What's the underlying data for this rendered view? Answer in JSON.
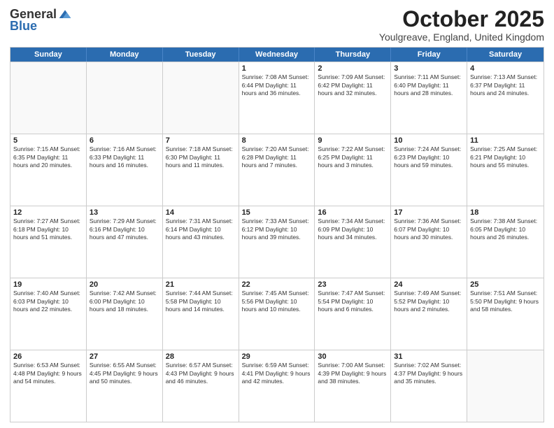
{
  "header": {
    "logo_general": "General",
    "logo_blue": "Blue",
    "title": "October 2025",
    "subtitle": "Youlgreave, England, United Kingdom"
  },
  "weekdays": [
    "Sunday",
    "Monday",
    "Tuesday",
    "Wednesday",
    "Thursday",
    "Friday",
    "Saturday"
  ],
  "rows": [
    [
      {
        "day": "",
        "info": ""
      },
      {
        "day": "",
        "info": ""
      },
      {
        "day": "",
        "info": ""
      },
      {
        "day": "1",
        "info": "Sunrise: 7:08 AM\nSunset: 6:44 PM\nDaylight: 11 hours\nand 36 minutes."
      },
      {
        "day": "2",
        "info": "Sunrise: 7:09 AM\nSunset: 6:42 PM\nDaylight: 11 hours\nand 32 minutes."
      },
      {
        "day": "3",
        "info": "Sunrise: 7:11 AM\nSunset: 6:40 PM\nDaylight: 11 hours\nand 28 minutes."
      },
      {
        "day": "4",
        "info": "Sunrise: 7:13 AM\nSunset: 6:37 PM\nDaylight: 11 hours\nand 24 minutes."
      }
    ],
    [
      {
        "day": "5",
        "info": "Sunrise: 7:15 AM\nSunset: 6:35 PM\nDaylight: 11 hours\nand 20 minutes."
      },
      {
        "day": "6",
        "info": "Sunrise: 7:16 AM\nSunset: 6:33 PM\nDaylight: 11 hours\nand 16 minutes."
      },
      {
        "day": "7",
        "info": "Sunrise: 7:18 AM\nSunset: 6:30 PM\nDaylight: 11 hours\nand 11 minutes."
      },
      {
        "day": "8",
        "info": "Sunrise: 7:20 AM\nSunset: 6:28 PM\nDaylight: 11 hours\nand 7 minutes."
      },
      {
        "day": "9",
        "info": "Sunrise: 7:22 AM\nSunset: 6:25 PM\nDaylight: 11 hours\nand 3 minutes."
      },
      {
        "day": "10",
        "info": "Sunrise: 7:24 AM\nSunset: 6:23 PM\nDaylight: 10 hours\nand 59 minutes."
      },
      {
        "day": "11",
        "info": "Sunrise: 7:25 AM\nSunset: 6:21 PM\nDaylight: 10 hours\nand 55 minutes."
      }
    ],
    [
      {
        "day": "12",
        "info": "Sunrise: 7:27 AM\nSunset: 6:18 PM\nDaylight: 10 hours\nand 51 minutes."
      },
      {
        "day": "13",
        "info": "Sunrise: 7:29 AM\nSunset: 6:16 PM\nDaylight: 10 hours\nand 47 minutes."
      },
      {
        "day": "14",
        "info": "Sunrise: 7:31 AM\nSunset: 6:14 PM\nDaylight: 10 hours\nand 43 minutes."
      },
      {
        "day": "15",
        "info": "Sunrise: 7:33 AM\nSunset: 6:12 PM\nDaylight: 10 hours\nand 39 minutes."
      },
      {
        "day": "16",
        "info": "Sunrise: 7:34 AM\nSunset: 6:09 PM\nDaylight: 10 hours\nand 34 minutes."
      },
      {
        "day": "17",
        "info": "Sunrise: 7:36 AM\nSunset: 6:07 PM\nDaylight: 10 hours\nand 30 minutes."
      },
      {
        "day": "18",
        "info": "Sunrise: 7:38 AM\nSunset: 6:05 PM\nDaylight: 10 hours\nand 26 minutes."
      }
    ],
    [
      {
        "day": "19",
        "info": "Sunrise: 7:40 AM\nSunset: 6:03 PM\nDaylight: 10 hours\nand 22 minutes."
      },
      {
        "day": "20",
        "info": "Sunrise: 7:42 AM\nSunset: 6:00 PM\nDaylight: 10 hours\nand 18 minutes."
      },
      {
        "day": "21",
        "info": "Sunrise: 7:44 AM\nSunset: 5:58 PM\nDaylight: 10 hours\nand 14 minutes."
      },
      {
        "day": "22",
        "info": "Sunrise: 7:45 AM\nSunset: 5:56 PM\nDaylight: 10 hours\nand 10 minutes."
      },
      {
        "day": "23",
        "info": "Sunrise: 7:47 AM\nSunset: 5:54 PM\nDaylight: 10 hours\nand 6 minutes."
      },
      {
        "day": "24",
        "info": "Sunrise: 7:49 AM\nSunset: 5:52 PM\nDaylight: 10 hours\nand 2 minutes."
      },
      {
        "day": "25",
        "info": "Sunrise: 7:51 AM\nSunset: 5:50 PM\nDaylight: 9 hours\nand 58 minutes."
      }
    ],
    [
      {
        "day": "26",
        "info": "Sunrise: 6:53 AM\nSunset: 4:48 PM\nDaylight: 9 hours\nand 54 minutes."
      },
      {
        "day": "27",
        "info": "Sunrise: 6:55 AM\nSunset: 4:45 PM\nDaylight: 9 hours\nand 50 minutes."
      },
      {
        "day": "28",
        "info": "Sunrise: 6:57 AM\nSunset: 4:43 PM\nDaylight: 9 hours\nand 46 minutes."
      },
      {
        "day": "29",
        "info": "Sunrise: 6:59 AM\nSunset: 4:41 PM\nDaylight: 9 hours\nand 42 minutes."
      },
      {
        "day": "30",
        "info": "Sunrise: 7:00 AM\nSunset: 4:39 PM\nDaylight: 9 hours\nand 38 minutes."
      },
      {
        "day": "31",
        "info": "Sunrise: 7:02 AM\nSunset: 4:37 PM\nDaylight: 9 hours\nand 35 minutes."
      },
      {
        "day": "",
        "info": ""
      }
    ]
  ]
}
